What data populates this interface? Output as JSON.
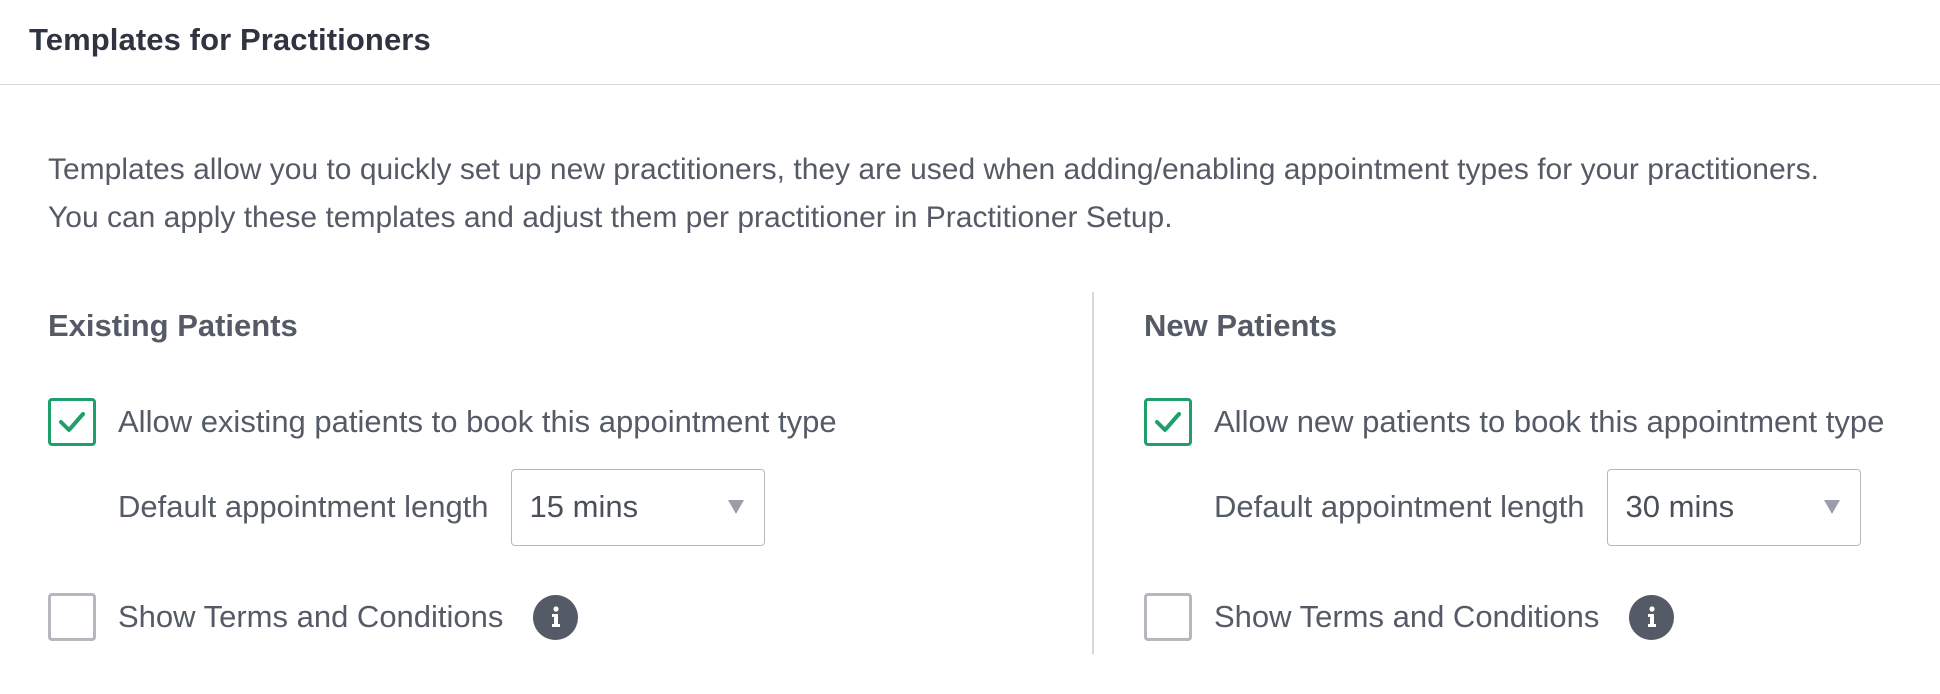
{
  "header": {
    "title": "Templates for Practitioners"
  },
  "intro": {
    "line1": "Templates allow you to quickly set up new practitioners, they are used when adding/enabling appointment types for your practitioners.",
    "line2": "You can apply these templates and adjust them per practitioner in Practitioner Setup."
  },
  "existing": {
    "title": "Existing Patients",
    "allow_label": "Allow existing patients to book this appointment type",
    "allow_checked": true,
    "length_label": "Default appointment length",
    "length_value": "15 mins",
    "terms_label": "Show Terms and Conditions",
    "terms_checked": false
  },
  "new": {
    "title": "New Patients",
    "allow_label": "Allow new patients to book this appointment type",
    "allow_checked": true,
    "length_label": "Default appointment length",
    "length_value": "30 mins",
    "terms_label": "Show Terms and Conditions",
    "terms_checked": false
  },
  "colors": {
    "accent_green": "#1fa06a",
    "text": "#555b66"
  },
  "icons": {
    "check": "check-icon",
    "info": "info-icon",
    "caret": "caret-down-icon"
  }
}
